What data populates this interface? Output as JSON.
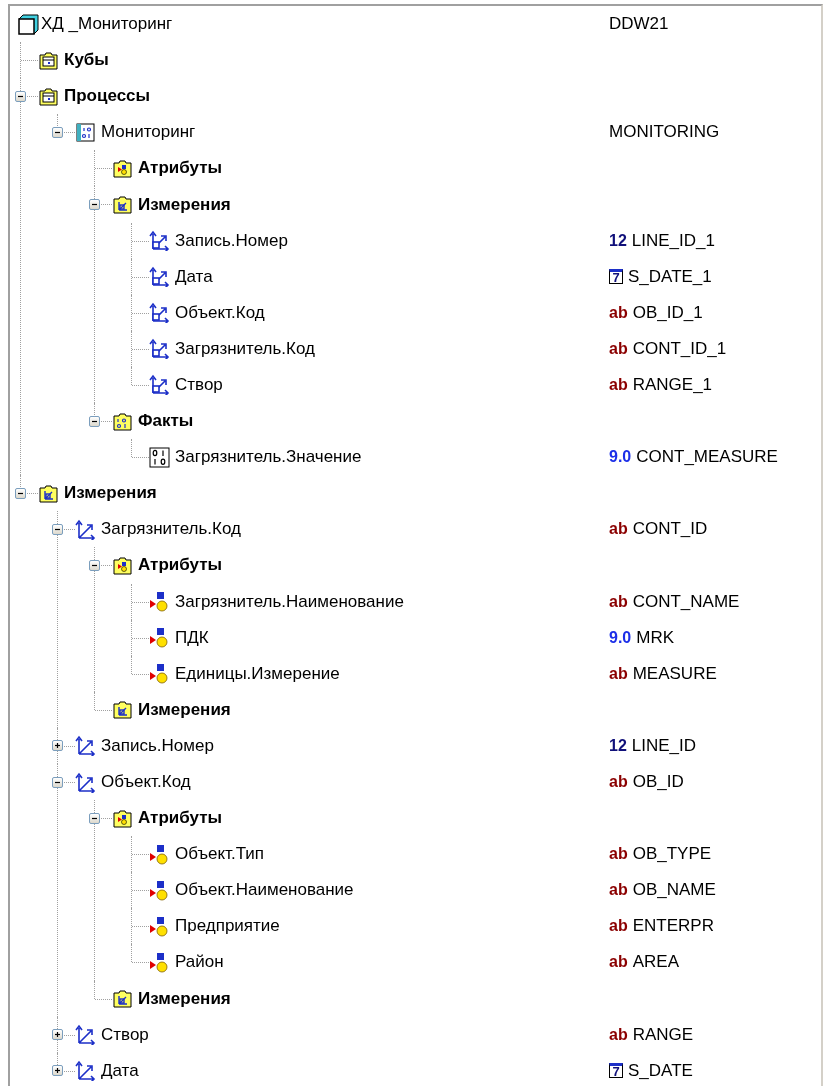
{
  "tree": [
    {
      "label": "ХД _Мониторинг",
      "kind": "root",
      "code": "DDW21",
      "children": [
        {
          "label": "Кубы",
          "kind": "folder-cube"
        },
        {
          "label": "Процессы",
          "kind": "folder-cube",
          "expanded": true,
          "children": [
            {
              "label": "Мониторинг",
              "kind": "process",
              "expanded": true,
              "code": "MONITORING",
              "children": [
                {
                  "label": "Атрибуты",
                  "kind": "folder-attr"
                },
                {
                  "label": "Измерения",
                  "kind": "folder-dim",
                  "expanded": true,
                  "children": [
                    {
                      "label": "Запись.Номер",
                      "kind": "dim-link",
                      "type": {
                        "kind": "number",
                        "text": "12"
                      },
                      "code": "LINE_ID_1"
                    },
                    {
                      "label": "Дата",
                      "kind": "dim-link",
                      "type": {
                        "kind": "date",
                        "text": "7"
                      },
                      "code": "S_DATE_1"
                    },
                    {
                      "label": "Объект.Код",
                      "kind": "dim-link",
                      "type": {
                        "kind": "string",
                        "text": "ab"
                      },
                      "code": "OB_ID_1"
                    },
                    {
                      "label": "Загрязнитель.Код",
                      "kind": "dim-link",
                      "type": {
                        "kind": "string",
                        "text": "ab"
                      },
                      "code": "CONT_ID_1"
                    },
                    {
                      "label": "Створ",
                      "kind": "dim-link",
                      "type": {
                        "kind": "string",
                        "text": "ab"
                      },
                      "code": "RANGE_1"
                    }
                  ]
                },
                {
                  "label": "Факты",
                  "kind": "folder-fact",
                  "expanded": true,
                  "children": [
                    {
                      "label": "Загрязнитель.Значение",
                      "kind": "measure",
                      "type": {
                        "kind": "float",
                        "text": "9.0"
                      },
                      "code": "CONT_MEASURE"
                    }
                  ]
                }
              ]
            }
          ]
        },
        {
          "label": "Измерения",
          "kind": "folder-dim",
          "expanded": true,
          "children": [
            {
              "label": "Загрязнитель.Код",
              "kind": "dim",
              "expanded": true,
              "type": {
                "kind": "string",
                "text": "ab"
              },
              "code": "CONT_ID",
              "children": [
                {
                  "label": "Атрибуты",
                  "kind": "folder-attr",
                  "expanded": true,
                  "children": [
                    {
                      "label": "Загрязнитель.Наименование",
                      "kind": "attribute",
                      "type": {
                        "kind": "string",
                        "text": "ab"
                      },
                      "code": "CONT_NAME"
                    },
                    {
                      "label": "ПДК",
                      "kind": "attribute",
                      "type": {
                        "kind": "float",
                        "text": "9.0"
                      },
                      "code": "MRK"
                    },
                    {
                      "label": "Единицы.Измерение",
                      "kind": "attribute",
                      "type": {
                        "kind": "string",
                        "text": "ab"
                      },
                      "code": "MEASURE"
                    }
                  ]
                },
                {
                  "label": "Измерения",
                  "kind": "folder-dim"
                }
              ]
            },
            {
              "label": "Запись.Номер",
              "kind": "dim",
              "expanded": false,
              "type": {
                "kind": "number",
                "text": "12"
              },
              "code": "LINE_ID"
            },
            {
              "label": "Объект.Код",
              "kind": "dim",
              "expanded": true,
              "type": {
                "kind": "string",
                "text": "ab"
              },
              "code": "OB_ID",
              "children": [
                {
                  "label": "Атрибуты",
                  "kind": "folder-attr",
                  "expanded": true,
                  "children": [
                    {
                      "label": "Объект.Тип",
                      "kind": "attribute",
                      "type": {
                        "kind": "string",
                        "text": "ab"
                      },
                      "code": "OB_TYPE"
                    },
                    {
                      "label": "Объект.Наименование",
                      "kind": "attribute",
                      "type": {
                        "kind": "string",
                        "text": "ab"
                      },
                      "code": "OB_NAME"
                    },
                    {
                      "label": "Предприятие",
                      "kind": "attribute",
                      "type": {
                        "kind": "string",
                        "text": "ab"
                      },
                      "code": "ENTERPR"
                    },
                    {
                      "label": "Район",
                      "kind": "attribute",
                      "type": {
                        "kind": "string",
                        "text": "ab"
                      },
                      "code": "AREA"
                    }
                  ]
                },
                {
                  "label": "Измерения",
                  "kind": "folder-dim"
                }
              ]
            },
            {
              "label": "Створ",
              "kind": "dim",
              "expanded": false,
              "type": {
                "kind": "string",
                "text": "ab"
              },
              "code": "RANGE"
            },
            {
              "label": "Дата",
              "kind": "dim",
              "expanded": false,
              "type": {
                "kind": "date",
                "text": "7"
              },
              "code": "S_DATE"
            }
          ]
        }
      ]
    }
  ]
}
